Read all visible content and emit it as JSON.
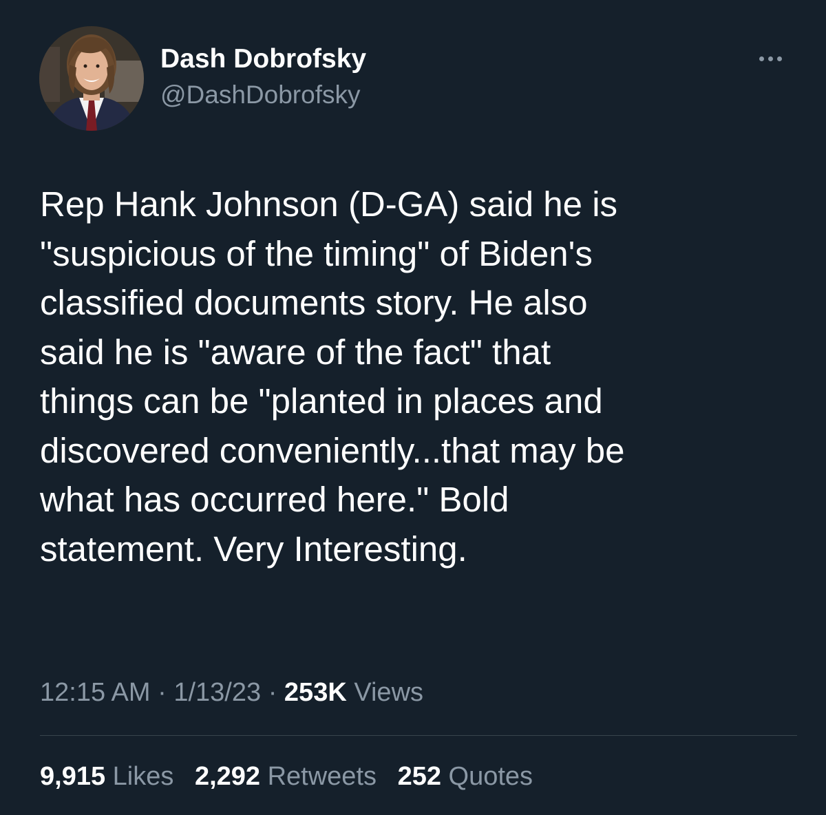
{
  "author": {
    "display_name": "Dash Dobrofsky",
    "handle": "@DashDobrofsky",
    "avatar_icon": "profile-photo"
  },
  "menu_icon": "more-horizontal-icon",
  "tweet": {
    "lines": [
      "Rep Hank Johnson  (D-GA) said he is",
      "\"suspicious of the timing\" of Biden's",
      "classified documents story. He also",
      "said he is \"aware of the fact\" that",
      "things can be \"planted in places and",
      "discovered conveniently...that may be",
      "what has occurred here.\" Bold",
      "statement. Very Interesting."
    ]
  },
  "meta": {
    "time": "12:15 AM",
    "separator": "·",
    "date": "1/13/23",
    "views_count": "253K",
    "views_label": "Views"
  },
  "stats": {
    "likes_count": "9,915",
    "likes_label": "Likes",
    "retweets_count": "2,292",
    "retweets_label": "Retweets",
    "quotes_count": "252",
    "quotes_label": "Quotes"
  },
  "colors": {
    "background": "#15202b",
    "primary_text": "#ffffff",
    "secondary_text": "#8b98a5",
    "divider": "#38444d"
  }
}
